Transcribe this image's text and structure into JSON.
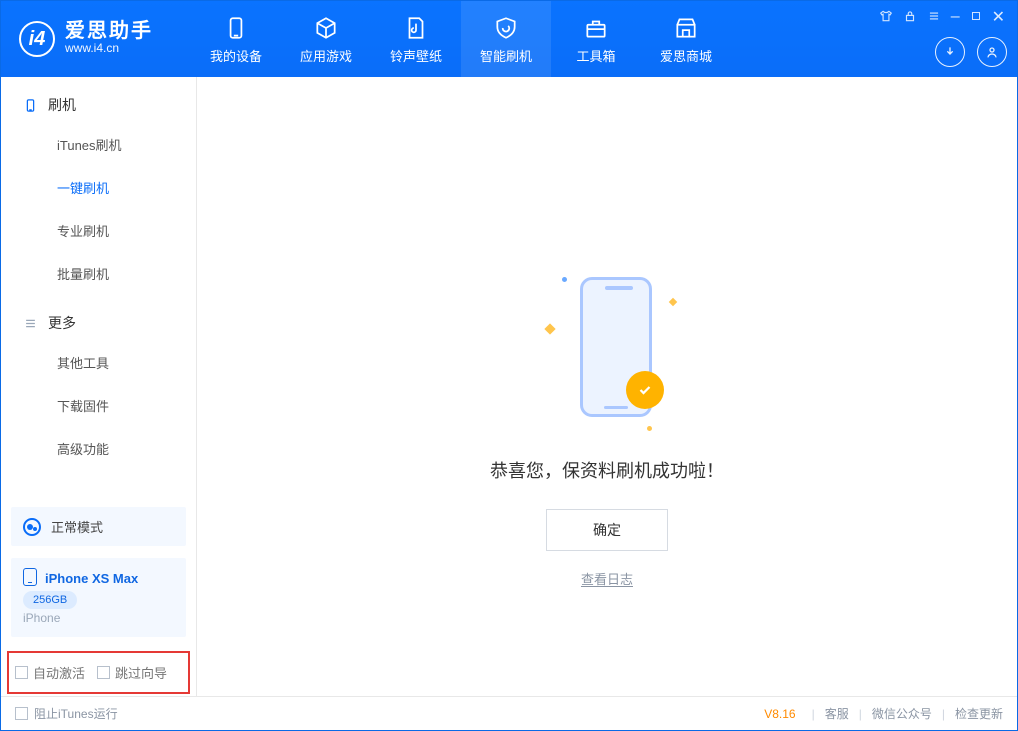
{
  "app": {
    "brand": "爱思助手",
    "domain": "www.i4.cn"
  },
  "nav": {
    "items": [
      {
        "label": "我的设备"
      },
      {
        "label": "应用游戏"
      },
      {
        "label": "铃声壁纸"
      },
      {
        "label": "智能刷机"
      },
      {
        "label": "工具箱"
      },
      {
        "label": "爱思商城"
      }
    ]
  },
  "sidebar": {
    "section1": "刷机",
    "items1": [
      {
        "label": "iTunes刷机"
      },
      {
        "label": "一键刷机"
      },
      {
        "label": "专业刷机"
      },
      {
        "label": "批量刷机"
      }
    ],
    "section2": "更多",
    "items2": [
      {
        "label": "其他工具"
      },
      {
        "label": "下载固件"
      },
      {
        "label": "高级功能"
      }
    ],
    "mode": "正常模式",
    "device": {
      "name": "iPhone XS Max",
      "storage": "256GB",
      "type": "iPhone"
    },
    "checks": {
      "auto_activate": "自动激活",
      "skip_guide": "跳过向导"
    }
  },
  "main": {
    "success_text": "恭喜您，保资料刷机成功啦！",
    "ok_btn": "确定",
    "log_link": "查看日志"
  },
  "footer": {
    "block_itunes": "阻止iTunes运行",
    "version": "V8.16",
    "links": {
      "support": "客服",
      "wechat": "微信公众号",
      "update": "检查更新"
    }
  }
}
